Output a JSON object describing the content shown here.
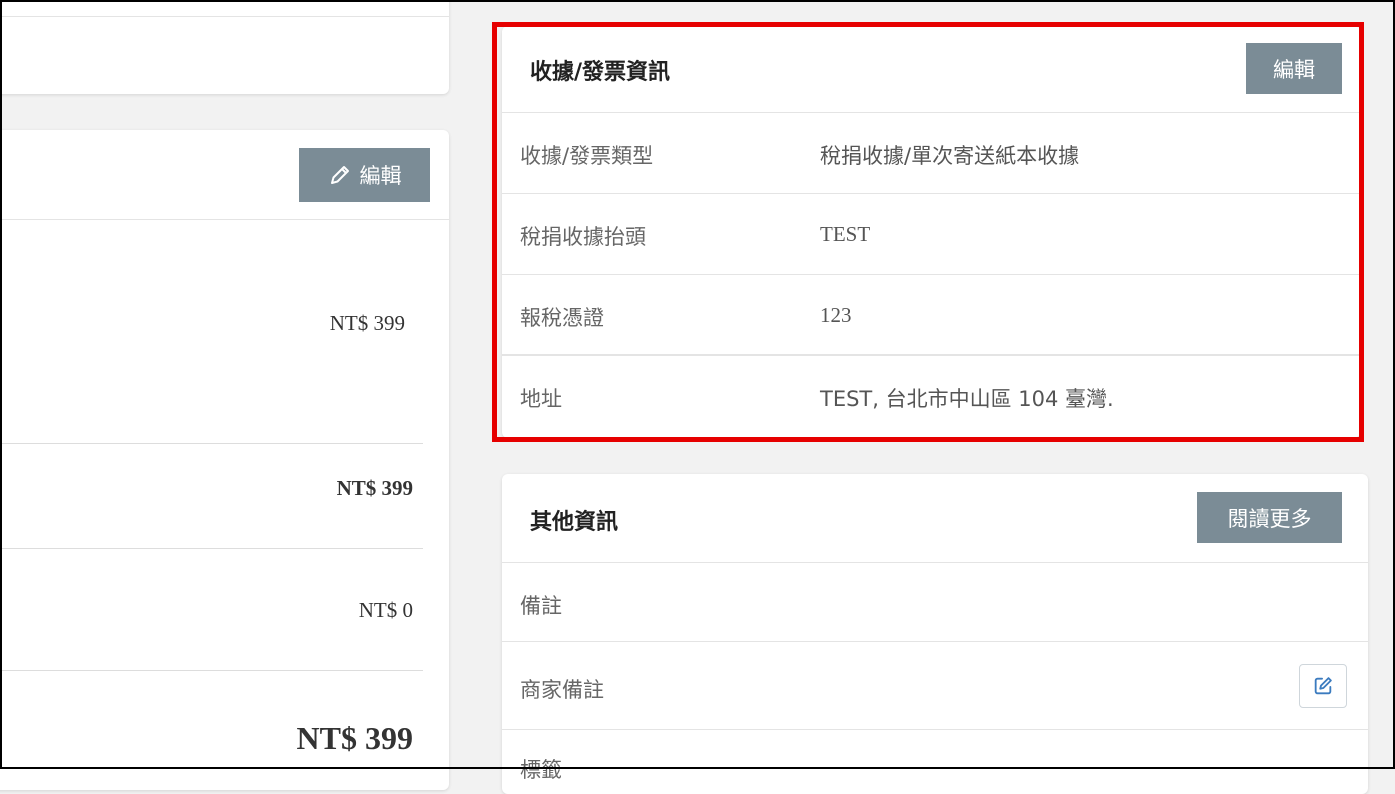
{
  "left_panel": {
    "edit_label": "編輯",
    "line_price": "NT$ 399",
    "subtotal": "NT$ 399",
    "shipping": "NT$ 0",
    "total": "NT$ 399"
  },
  "receipt": {
    "title": "收據/發票資訊",
    "edit_label": "編輯",
    "rows": [
      {
        "label": "收據/發票類型",
        "value": "稅捐收據/單次寄送紙本收據"
      },
      {
        "label": "稅捐收據抬頭",
        "value": "TEST"
      },
      {
        "label": "報稅憑證",
        "value": "123"
      },
      {
        "label": "地址",
        "value": "TEST, 台北市中山區 104 臺灣."
      }
    ]
  },
  "other": {
    "title": "其他資訊",
    "read_more_label": "閱讀更多",
    "rows": [
      {
        "label": "備註"
      },
      {
        "label": "商家備註"
      },
      {
        "label": "標籤"
      }
    ]
  },
  "colors": {
    "highlight": "#e60000",
    "button": "#7b8c96",
    "edit_icon": "#3b7bbf"
  }
}
